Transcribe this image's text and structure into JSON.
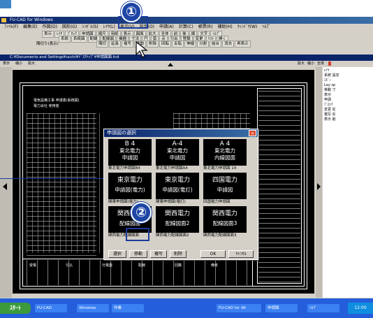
{
  "app": {
    "window_title": "FU-CAD for Windows",
    "menu": [
      "ﾌｧｲﾙ(F)",
      "編集(E)",
      "作図(D)",
      "図形(G)",
      "ｼﾝﾎﾞﾙ(S)",
      "ﾚｲﾔ(L)",
      "表示(V)",
      "設定(O)",
      "申請(A)",
      "計算(C)",
      "帳票(R)",
      "補助(H)",
      "ｳｨﾝﾄﾞｳ(W)",
      "ﾍﾙﾌﾟ"
    ],
    "toolbar_row1": [
      "表示",
      "ﾚｲﾔ",
      "ﾌﾞﾛｯｸ",
      "申請図",
      "縮尺",
      "用紙",
      "表示",
      "図面",
      "拡大",
      "全体",
      "前",
      "後",
      "線",
      "文字",
      "ﾍﾙﾌﾟ"
    ],
    "toolbar_row2": [
      "系統",
      "系統図",
      "配線",
      "配線図",
      "機器",
      "寸法",
      "円",
      "弧",
      "点",
      "引出",
      "登録",
      "変更",
      "ﾘｽﾄ",
      "開く"
    ],
    "toolbar_row3": [
      "隅切",
      "延長",
      "複写",
      "移動",
      "削除",
      "回転",
      "反転",
      "伸縮",
      "分割",
      "結合",
      "消去",
      "再表示"
    ],
    "toolbar_left": "隅切り(表示)"
  },
  "document": {
    "title": "C:¥Documents and Settings¥ucchi¥ﾃﾞｽｸﾄｯﾌﾟ¥申請図面.fcd",
    "menu": [
      "表示",
      "縮小",
      "拡大"
    ],
    "status_right": [
      "拡大",
      "縮小",
      "全体"
    ]
  },
  "callouts": {
    "step1": "①",
    "step2": "②"
  },
  "dialog": {
    "title": "申請図の選択",
    "close": "×",
    "cells": [
      {
        "line1": "B 4",
        "line2": "東北電力",
        "line3": "申請図",
        "caption": "東北電力申請図B4"
      },
      {
        "line1": "A-4",
        "line2": "東北電力",
        "line3": "申請図",
        "caption": "東北電力申請図A4"
      },
      {
        "line1": "A 4",
        "line2": "東北電力",
        "line3": "内線図面",
        "caption": "東北電力申請図 14"
      },
      {
        "line1": "東京電力",
        "line2": "申請図(電力)",
        "line3": "",
        "caption": "関東申請図(電力)"
      },
      {
        "line1": "東京電力",
        "line2": "申請図(電灯)",
        "line3": "",
        "caption": "関東申請図(電灯)"
      },
      {
        "line1": "四国電力",
        "line2": "申請図",
        "line3": "",
        "caption": "四国電力申請図"
      },
      {
        "line1": "関西電力",
        "line2": "配線図面",
        "line3": "",
        "caption": "関西電力配線図面"
      },
      {
        "line1": "関西電力",
        "line2": "配線図面2",
        "line3": "",
        "caption": "関西電力配線図面2"
      },
      {
        "line1": "関西電力",
        "line2": "配線図面3",
        "line3": "",
        "caption": "関西電力配線図面3"
      }
    ],
    "buttons": {
      "select": "選択",
      "move": "移動",
      "copy": "複写",
      "delete": "削除",
      "ok": "OK",
      "cancel": "ｷｬﾝｾﾙ"
    }
  },
  "right_panel": {
    "lines": [
      "ﾚｲﾔ",
      "系統 設定",
      "ｺﾋﾟｰ",
      "Lay sp",
      "移動 寸",
      "表示",
      "申請",
      "ﾌﾞﾛｯｸ",
      "変更 反",
      "複写 反",
      "表示 削"
    ]
  },
  "cad_text": {
    "heading": "電気設備工事 申請書(系統図)",
    "sub": "電力会社 使用者",
    "labels": [
      "受電",
      "引込",
      "分電盤",
      "配線",
      "回路",
      "備考"
    ]
  },
  "taskbar": {
    "start": "ｽﾀｰﾄ",
    "tasks": [
      "FU-CAD",
      "Windows",
      "作業",
      "FU-CAD for Wi",
      "申請図",
      "ﾍﾙﾌﾟ"
    ],
    "clock": "12:00"
  },
  "colors": {
    "accent": "#1e46a6",
    "titlebar": "#0a246a",
    "canvas": "#000000",
    "dialog_bg": "#d4d0c8"
  }
}
